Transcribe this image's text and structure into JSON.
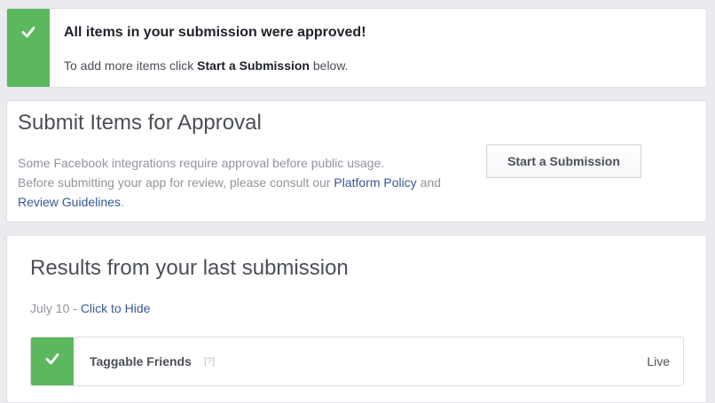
{
  "banner": {
    "title": "All items in your submission were approved!",
    "body_prefix": "To add more items click ",
    "body_bold": "Start a Submission",
    "body_suffix": " below.",
    "icon": "check-icon",
    "accent_color": "#5cb85c"
  },
  "submit": {
    "title": "Submit Items for Approval",
    "desc_line1": "Some Facebook integrations require approval before public usage.",
    "desc_line2": "Before submitting your app for review, please consult our ",
    "link_platform_policy": "Platform Policy",
    "desc_and": " and ",
    "link_review_guidelines": "Review Guidelines",
    "desc_end": ".",
    "button_label": "Start a Submission"
  },
  "results": {
    "title": "Results from your last submission",
    "date": "July 10",
    "date_sep": " - ",
    "hide_link": "Click to Hide",
    "items": [
      {
        "name": "Taggable Friends",
        "help": "[?]",
        "status": "Live",
        "icon": "check-icon"
      }
    ]
  }
}
